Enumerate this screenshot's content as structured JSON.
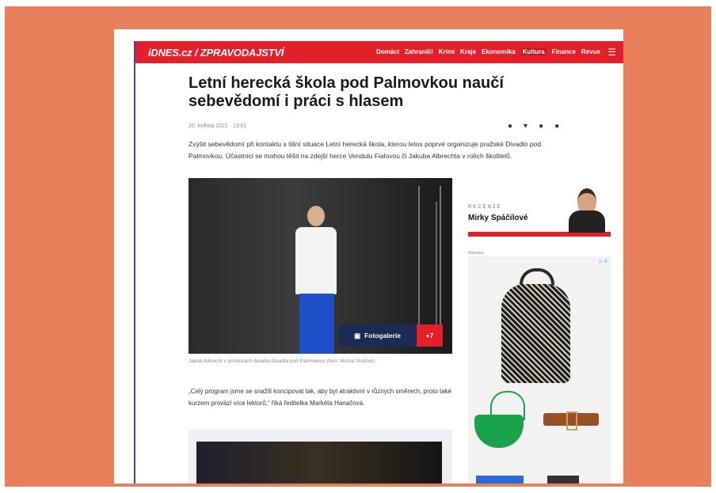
{
  "header": {
    "logo": "iDNES.cz / ZPRAVODAJSTVÍ",
    "nav": [
      "Domácí",
      "Zahraničí",
      "Krimi",
      "Kraje",
      "Ekonomika",
      "Kultura",
      "Finance",
      "Revue"
    ],
    "active_nav": "Kultura",
    "menu_icon": "☰"
  },
  "article": {
    "title": "Letní herecká škola pod Palmovkou naučí sebevědomí i práci s hlasem",
    "meta": "20. května 2021 · 13:01",
    "share_icons": [
      "facebook-icon",
      "twitter-icon",
      "messenger-icon",
      "email-icon"
    ],
    "perex": "Zvýšit sebevědomí při kontaktu s tišní situace Letní herecká škola, kterou letos poprvé organizuje pražské Divadlo pod Palmovkou. Účastníci se mohou těšit na zdejší herce Vendulu Fialovou či Jakuba Albrechta v rolích školitelů.",
    "gallery_label": "Fotogalerie",
    "gallery_count": "+7",
    "photo_caption": "Jakub Albrecht v prostorách divadla Divadla pod Palmovkou (foto: Michal Sváček)",
    "quote": "„Celý program jsme se snažili koncipovat tak, aby byl atraktivní v různých směrech, proto také kurzem provází více lektorů,“ říká ředitelka Markéta Hanačová."
  },
  "sidebar": {
    "review_kicker": "RECENZE",
    "review_name": "Mirky Spáčilové",
    "ad_label": "Reklama",
    "ad_tag": "▷ X"
  },
  "colors": {
    "frame": "#e9805c",
    "brand_red": "#e3202a"
  }
}
